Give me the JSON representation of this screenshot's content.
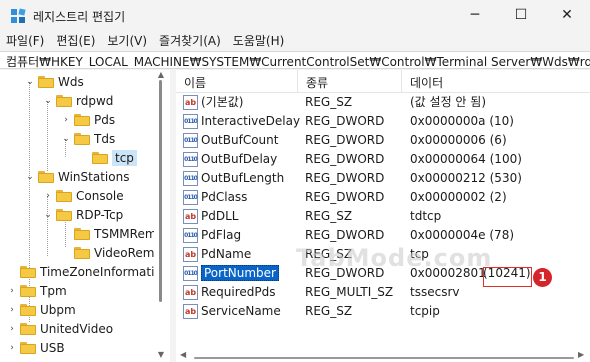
{
  "window": {
    "title": "레지스트리 편집기",
    "buttons": {
      "minimize": "─",
      "maximize": "☐",
      "close": "✕"
    }
  },
  "menu": [
    "파일(F)",
    "편집(E)",
    "보기(V)",
    "즐겨찾기(A)",
    "도움말(H)"
  ],
  "address": "컴퓨터₩HKEY_LOCAL_MACHINE₩SYSTEM₩CurrentControlSet₩Control₩Terminal Server₩Wds₩rdpwd₩Tds₩tcp",
  "tree": [
    {
      "label": "Wds",
      "chevron": "⌄"
    },
    {
      "label": "rdpwd",
      "chevron": "⌄"
    },
    {
      "label": "Pds",
      "chevron": "›"
    },
    {
      "label": "Tds",
      "chevron": "⌄"
    },
    {
      "label": "tcp",
      "chevron": "",
      "selected": true
    },
    {
      "label": "WinStations",
      "chevron": "⌄"
    },
    {
      "label": "Console",
      "chevron": "›"
    },
    {
      "label": "RDP-Tcp",
      "chevron": "⌄"
    },
    {
      "label": "TSMMRemo",
      "chevron": ""
    },
    {
      "label": "VideoRemo",
      "chevron": ""
    },
    {
      "label": "TimeZoneInformatio",
      "chevron": ""
    },
    {
      "label": "Tpm",
      "chevron": "›"
    },
    {
      "label": "Ubpm",
      "chevron": "›"
    },
    {
      "label": "UnitedVideo",
      "chevron": "›"
    },
    {
      "label": "USB",
      "chevron": "›"
    }
  ],
  "columns": {
    "name": "이름",
    "type": "종류",
    "data": "데이터"
  },
  "values": [
    {
      "name": "(기본값)",
      "type": "REG_SZ",
      "data": "(값 설정 안 됨)",
      "icon": "ab"
    },
    {
      "name": "InteractiveDelay",
      "type": "REG_DWORD",
      "data": "0x0000000a (10)",
      "icon": "bin"
    },
    {
      "name": "OutBufCount",
      "type": "REG_DWORD",
      "data": "0x00000006 (6)",
      "icon": "bin"
    },
    {
      "name": "OutBufDelay",
      "type": "REG_DWORD",
      "data": "0x00000064 (100)",
      "icon": "bin"
    },
    {
      "name": "OutBufLength",
      "type": "REG_DWORD",
      "data": "0x00000212 (530)",
      "icon": "bin"
    },
    {
      "name": "PdClass",
      "type": "REG_DWORD",
      "data": "0x00000002 (2)",
      "icon": "bin"
    },
    {
      "name": "PdDLL",
      "type": "REG_SZ",
      "data": "tdtcp",
      "icon": "ab"
    },
    {
      "name": "PdFlag",
      "type": "REG_DWORD",
      "data": "0x0000004e (78)",
      "icon": "bin"
    },
    {
      "name": "PdName",
      "type": "REG_SZ",
      "data": "tcp",
      "icon": "ab"
    },
    {
      "name": "PortNumber",
      "type": "REG_DWORD",
      "data": "0x00002801",
      "data_suffix": "(10241)",
      "icon": "bin",
      "selected": true
    },
    {
      "name": "RequiredPds",
      "type": "REG_MULTI_SZ",
      "data": "tssecsrv",
      "icon": "ab"
    },
    {
      "name": "ServiceName",
      "type": "REG_SZ",
      "data": "tcpip",
      "icon": "ab"
    }
  ],
  "annotation": {
    "badge": "1"
  },
  "watermark": "TabMode.com",
  "icons": {
    "app": "registry-editor-icon",
    "value_string": "ab",
    "value_binary": "011\n110"
  },
  "colors": {
    "selection": "#0a64c8",
    "tree_selection": "#cce4f7",
    "annotation_red": "#d6252a"
  }
}
